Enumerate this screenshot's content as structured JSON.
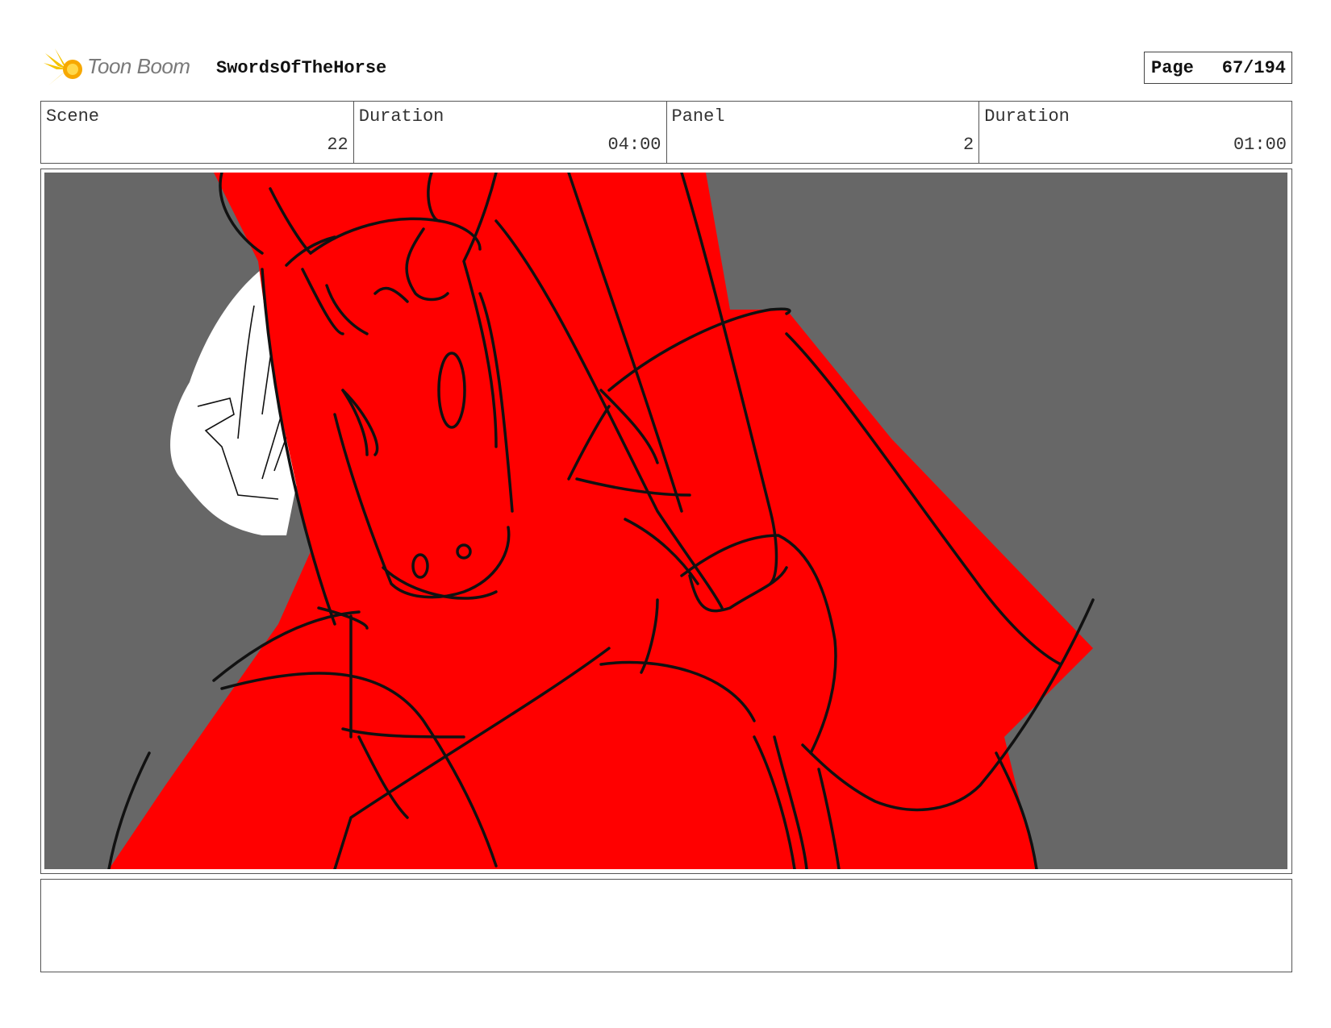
{
  "header": {
    "logo_text": "Toon Boom",
    "project_title": "SwordsOfTheHorse",
    "page_label": "Page",
    "page_number": "67/194"
  },
  "info": {
    "scene_label": "Scene",
    "scene_value": "22",
    "scene_duration_label": "Duration",
    "scene_duration_value": "04:00",
    "panel_label": "Panel",
    "panel_value": "2",
    "panel_duration_label": "Duration",
    "panel_duration_value": "01:00"
  },
  "colors": {
    "background": "#676767",
    "figure": "#ff0000",
    "line": "#000000",
    "logo": "#f5c400"
  },
  "notes": {
    "text": ""
  }
}
